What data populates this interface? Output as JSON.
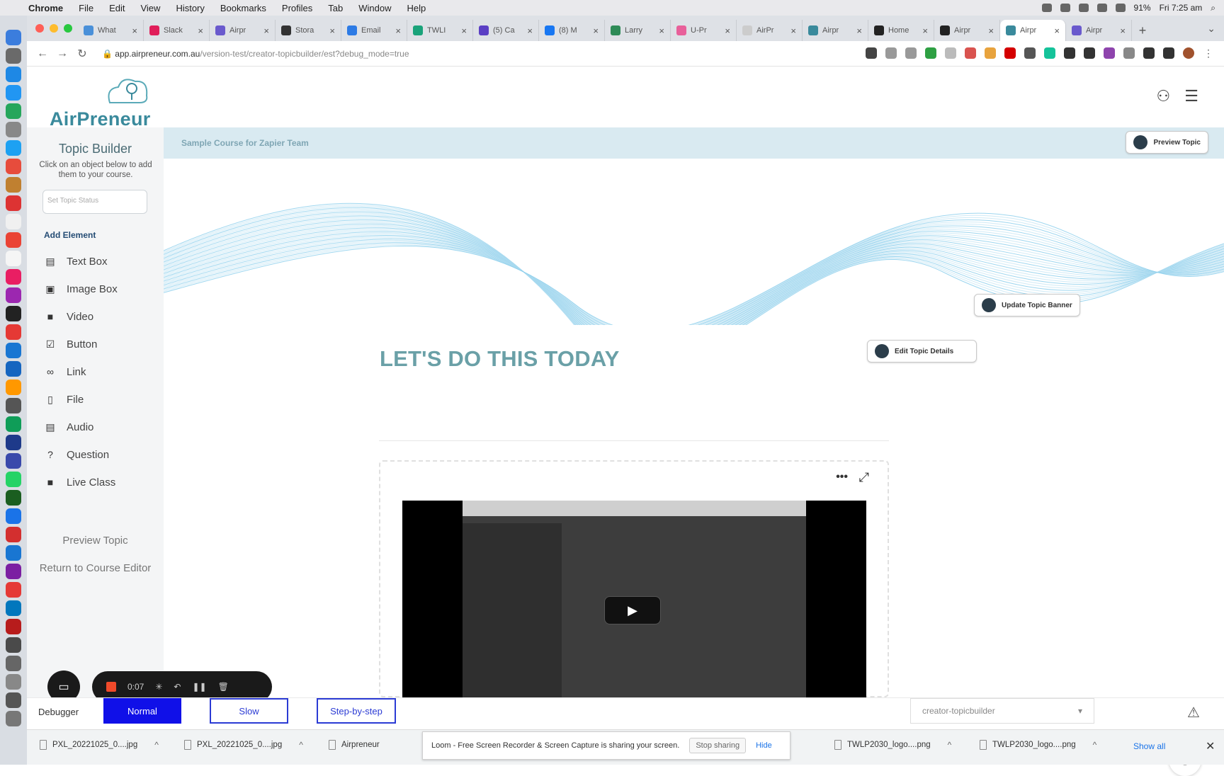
{
  "menubar": {
    "items": [
      "Chrome",
      "File",
      "Edit",
      "View",
      "History",
      "Bookmarks",
      "Profiles",
      "Tab",
      "Window",
      "Help"
    ],
    "battery": "91%",
    "clock": "Fri 7:25 am"
  },
  "browser": {
    "tabs": [
      {
        "label": "What",
        "color": "#4a90d9"
      },
      {
        "label": "Slack",
        "color": "#e01e5a"
      },
      {
        "label": "Airpr",
        "color": "#6a5acd"
      },
      {
        "label": "Stora",
        "color": "#333333"
      },
      {
        "label": "Email",
        "color": "#2d7be5"
      },
      {
        "label": "TWLI",
        "color": "#1aa37a"
      },
      {
        "label": "(5) Ca",
        "color": "#5b3fc4"
      },
      {
        "label": "(8) M",
        "color": "#1877f2"
      },
      {
        "label": "Larry",
        "color": "#2e8b57"
      },
      {
        "label": "U-Pr",
        "color": "#e8609a"
      },
      {
        "label": "AirPr",
        "color": "#cccccc"
      },
      {
        "label": "Airpr",
        "color": "#3a8a9c"
      },
      {
        "label": "Home",
        "color": "#222222"
      },
      {
        "label": "Airpr",
        "color": "#222222"
      },
      {
        "label": "Airpr",
        "color": "#3a8a9c",
        "active": true
      },
      {
        "label": "Airpr",
        "color": "#6a5acd"
      }
    ],
    "url_host": "app.airpreneur.com.au",
    "url_path": "/version-test/creator-topicbuilder/est?debug_mode=true"
  },
  "app": {
    "logo_text": "AirPreneur",
    "sidebar": {
      "title": "Topic Builder",
      "subtitle": "Click on an object below to add them to your course.",
      "select_placeholder": "Set Topic Status",
      "add_label": "Add Element",
      "items": [
        {
          "label": "Text Box",
          "icon": "text-box-icon"
        },
        {
          "label": "Image Box",
          "icon": "image-box-icon"
        },
        {
          "label": "Video",
          "icon": "video-icon"
        },
        {
          "label": "Button",
          "icon": "checkbox-icon"
        },
        {
          "label": "Link",
          "icon": "link-icon"
        },
        {
          "label": "File",
          "icon": "file-icon"
        },
        {
          "label": "Audio",
          "icon": "audio-icon"
        },
        {
          "label": "Question",
          "icon": "question-icon"
        },
        {
          "label": "Live Class",
          "icon": "live-class-icon"
        }
      ],
      "preview_label": "Preview Topic",
      "return_label": "Return to Course Editor"
    },
    "header": {
      "course_name": "Sample Course for Zapier Team",
      "preview_button": "Preview Topic"
    },
    "banner_button": "Update Topic Banner",
    "topic_title": "LET'S DO THIS TODAY",
    "edit_button": "Edit Topic Details"
  },
  "debugger": {
    "label": "Debugger",
    "normal": "Normal",
    "slow": "Slow",
    "step": "Step-by-step",
    "page_select": "creator-topicbuilder"
  },
  "loom": {
    "timer": "0:07"
  },
  "downloads": {
    "items": [
      "PXL_20221025_0....jpg",
      "PXL_20221025_0....jpg",
      "Airpreneur",
      "TWLP2030_logo....png",
      "TWLP2030_logo....png"
    ],
    "share_text": "Loom - Free Screen Recorder & Screen Capture is sharing your screen.",
    "stop_sharing": "Stop sharing",
    "hide": "Hide",
    "show_all": "Show all"
  },
  "colors": {
    "brand": "#3a8a9c",
    "heading": "#6aa0a7",
    "debug_active": "#1010e8"
  }
}
